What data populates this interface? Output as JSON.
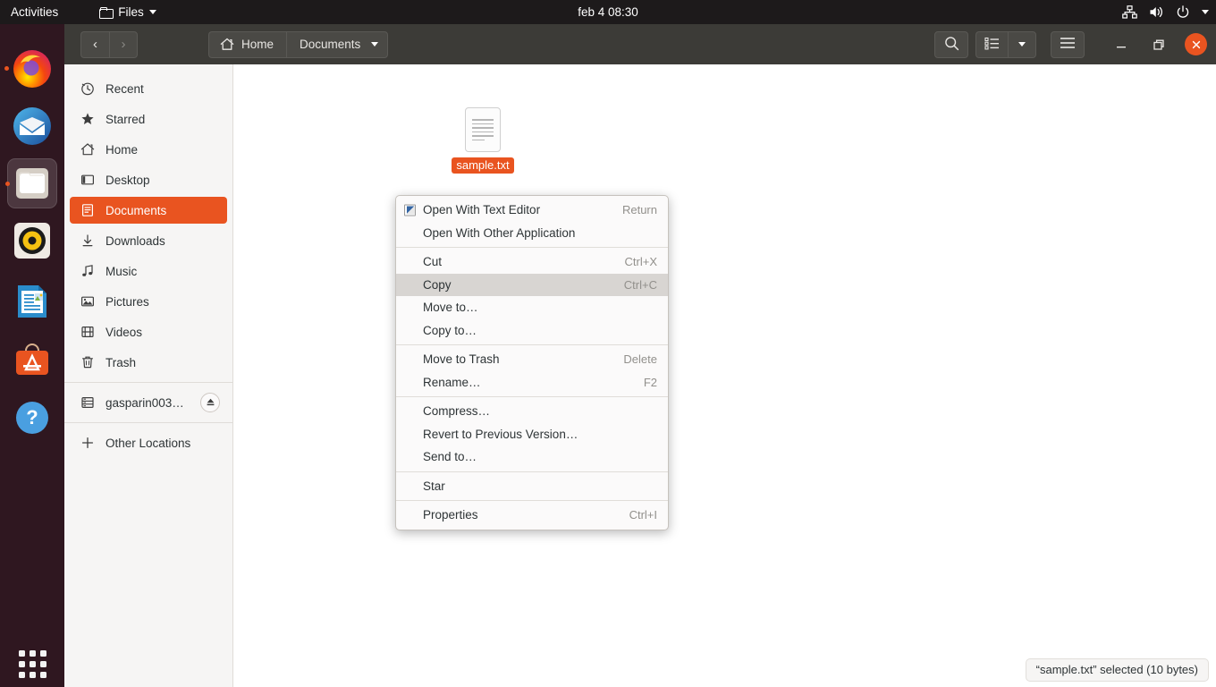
{
  "topbar": {
    "activities": "Activities",
    "app_name": "Files",
    "clock": "feb 4  08:30",
    "status_icons": [
      "network-icon",
      "volume-icon",
      "power-icon",
      "chevron-down-icon"
    ]
  },
  "dock": {
    "items": [
      {
        "name": "firefox",
        "label": "Firefox",
        "running": true,
        "active": false
      },
      {
        "name": "thunderbird",
        "label": "Thunderbird",
        "running": false,
        "active": false
      },
      {
        "name": "files",
        "label": "Files",
        "running": true,
        "active": true
      },
      {
        "name": "rhythmbox",
        "label": "Rhythmbox",
        "running": false,
        "active": false
      },
      {
        "name": "libreoffice-writer",
        "label": "LibreOffice Writer",
        "running": false,
        "active": false
      },
      {
        "name": "ubuntu-software",
        "label": "Ubuntu Software",
        "running": false,
        "active": false
      },
      {
        "name": "help",
        "label": "Help",
        "running": false,
        "active": false
      }
    ],
    "app_grid": "show-applications"
  },
  "window": {
    "headerbar": {
      "back_label": "‹",
      "forward_label": "›",
      "breadcrumbs": [
        {
          "label": "Home",
          "icon": "home-icon"
        },
        {
          "label": "Documents",
          "icon": "chevron-down-icon"
        }
      ],
      "search_icon": "search-icon",
      "view_icon": "list-view-icon",
      "view_options_icon": "chevron-down-icon",
      "menu_icon": "hamburger-menu-icon",
      "minimize_label": "–",
      "maximize_label": "❐",
      "close_label": "×"
    },
    "sidebar": {
      "items": [
        {
          "label": "Recent",
          "icon": "clock-icon",
          "selected": false
        },
        {
          "label": "Starred",
          "icon": "star-icon",
          "selected": false
        },
        {
          "label": "Home",
          "icon": "home-icon",
          "selected": false
        },
        {
          "label": "Desktop",
          "icon": "desktop-icon",
          "selected": false
        },
        {
          "label": "Documents",
          "icon": "documents-icon",
          "selected": true
        },
        {
          "label": "Downloads",
          "icon": "download-icon",
          "selected": false
        },
        {
          "label": "Music",
          "icon": "music-note-icon",
          "selected": false
        },
        {
          "label": "Pictures",
          "icon": "image-icon",
          "selected": false
        },
        {
          "label": "Videos",
          "icon": "film-icon",
          "selected": false
        },
        {
          "label": "Trash",
          "icon": "trash-icon",
          "selected": false
        }
      ],
      "drive": {
        "label": "gasparin003…",
        "icon": "drive-icon",
        "eject_icon": "eject-icon"
      },
      "other_locations": {
        "label": "Other Locations",
        "icon": "plus-icon"
      }
    },
    "content": {
      "files": [
        {
          "name": "sample.txt",
          "icon": "text-file-icon",
          "selected": true
        }
      ]
    },
    "statusbar": {
      "text": "“sample.txt” selected  (10 bytes)"
    }
  },
  "context_menu": {
    "items": [
      {
        "label": "Open With Text Editor",
        "accel": "Return",
        "icon": "text-editor-icon",
        "highlight": false,
        "separator_after": false
      },
      {
        "label": "Open With Other Application",
        "accel": "",
        "icon": "",
        "highlight": false,
        "separator_after": true
      },
      {
        "label": "Cut",
        "accel": "Ctrl+X",
        "icon": "",
        "highlight": false,
        "separator_after": false
      },
      {
        "label": "Copy",
        "accel": "Ctrl+C",
        "icon": "",
        "highlight": true,
        "separator_after": false
      },
      {
        "label": "Move to…",
        "accel": "",
        "icon": "",
        "highlight": false,
        "separator_after": false
      },
      {
        "label": "Copy to…",
        "accel": "",
        "icon": "",
        "highlight": false,
        "separator_after": true
      },
      {
        "label": "Move to Trash",
        "accel": "Delete",
        "icon": "",
        "highlight": false,
        "separator_after": false
      },
      {
        "label": "Rename…",
        "accel": "F2",
        "icon": "",
        "highlight": false,
        "separator_after": true
      },
      {
        "label": "Compress…",
        "accel": "",
        "icon": "",
        "highlight": false,
        "separator_after": false
      },
      {
        "label": "Revert to Previous Version…",
        "accel": "",
        "icon": "",
        "highlight": false,
        "separator_after": false
      },
      {
        "label": "Send to…",
        "accel": "",
        "icon": "",
        "highlight": false,
        "separator_after": true
      },
      {
        "label": "Star",
        "accel": "",
        "icon": "",
        "highlight": false,
        "separator_after": true
      },
      {
        "label": "Properties",
        "accel": "Ctrl+I",
        "icon": "",
        "highlight": false,
        "separator_after": false
      }
    ]
  },
  "colors": {
    "accent": "#e95420",
    "topbar_bg": "#1d1a1b",
    "headerbar_bg": "#3c3b37",
    "sidebar_bg": "#f6f5f4",
    "dock_bg": "#2c0b16"
  }
}
